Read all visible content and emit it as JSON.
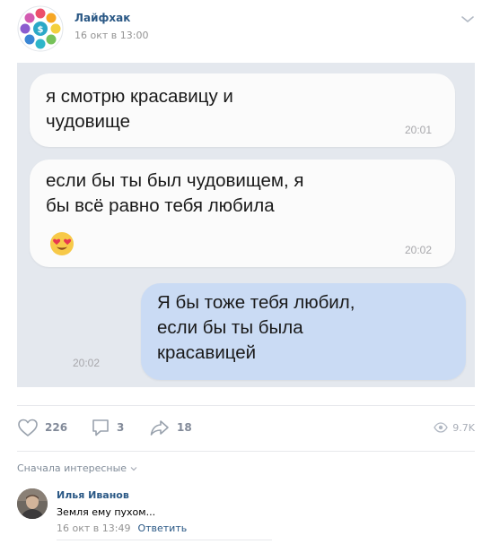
{
  "post": {
    "group_name": "Лайфхак",
    "date": "16 окт в 13:00",
    "group_avatar_icon": "lifehack-logo-icon"
  },
  "screenshot": {
    "messages": [
      {
        "lines": [
          "я смотрю красавицу и",
          "чудовище"
        ],
        "time": "20:01",
        "side": "left"
      },
      {
        "lines": [
          "если бы ты был чудовищем, я",
          "бы всё равно тебя любила"
        ],
        "time": "20:02",
        "side": "left",
        "emoji": "heart-eyes-emoji"
      },
      {
        "lines": [
          "Я бы тоже тебя любил,",
          "если бы ты была",
          "красавицей"
        ],
        "time": "20:02",
        "side": "right"
      }
    ],
    "colors": {
      "background": "#e4e8ee",
      "incoming_bubble": "#fbfbfb",
      "outgoing_bubble": "#cadbf4"
    }
  },
  "actions": {
    "likes": "226",
    "comments": "3",
    "shares": "18",
    "views": "9.7K"
  },
  "comments_section": {
    "sort_label": "Сначала интересные",
    "comments": [
      {
        "author": "Илья Иванов",
        "text": "Земля ему пухом...",
        "date": "16 окт в 13:49",
        "reply_label": "Ответить"
      }
    ]
  },
  "colors": {
    "link": "#2a5885",
    "muted": "#939393",
    "action": "#828a99"
  }
}
